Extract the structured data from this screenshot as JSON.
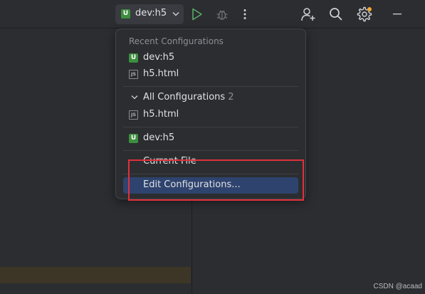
{
  "toolbar": {
    "run_config": {
      "badge": "U",
      "label": "dev:h5"
    },
    "icons": [
      "chevron-down-icon",
      "run-icon",
      "debug-icon",
      "more-icon",
      "add-user-icon",
      "search-icon",
      "settings-icon",
      "minimize-icon"
    ],
    "settings_notification_color": "#f0a732"
  },
  "popup": {
    "recent_header": "Recent Configurations",
    "recent_items": [
      {
        "icon": "npm-config-icon",
        "label": "dev:h5"
      },
      {
        "icon": "js-file-icon",
        "label": "h5.html"
      }
    ],
    "all_header": {
      "label": "All Configurations",
      "count": "2"
    },
    "all_items": [
      {
        "icon": "js-file-icon",
        "label": "h5.html"
      }
    ],
    "pinned_item": {
      "icon": "npm-config-icon",
      "label": "dev:h5"
    },
    "current_file": "Current File",
    "edit_configurations": "Edit Configurations..."
  },
  "badges": {
    "npm": "U",
    "js": "JS"
  },
  "watermark": "CSDN @acaad",
  "colors": {
    "accent_selected": "#2e436e",
    "run_green": "#59a869",
    "annotation_red": "#e0303a"
  }
}
